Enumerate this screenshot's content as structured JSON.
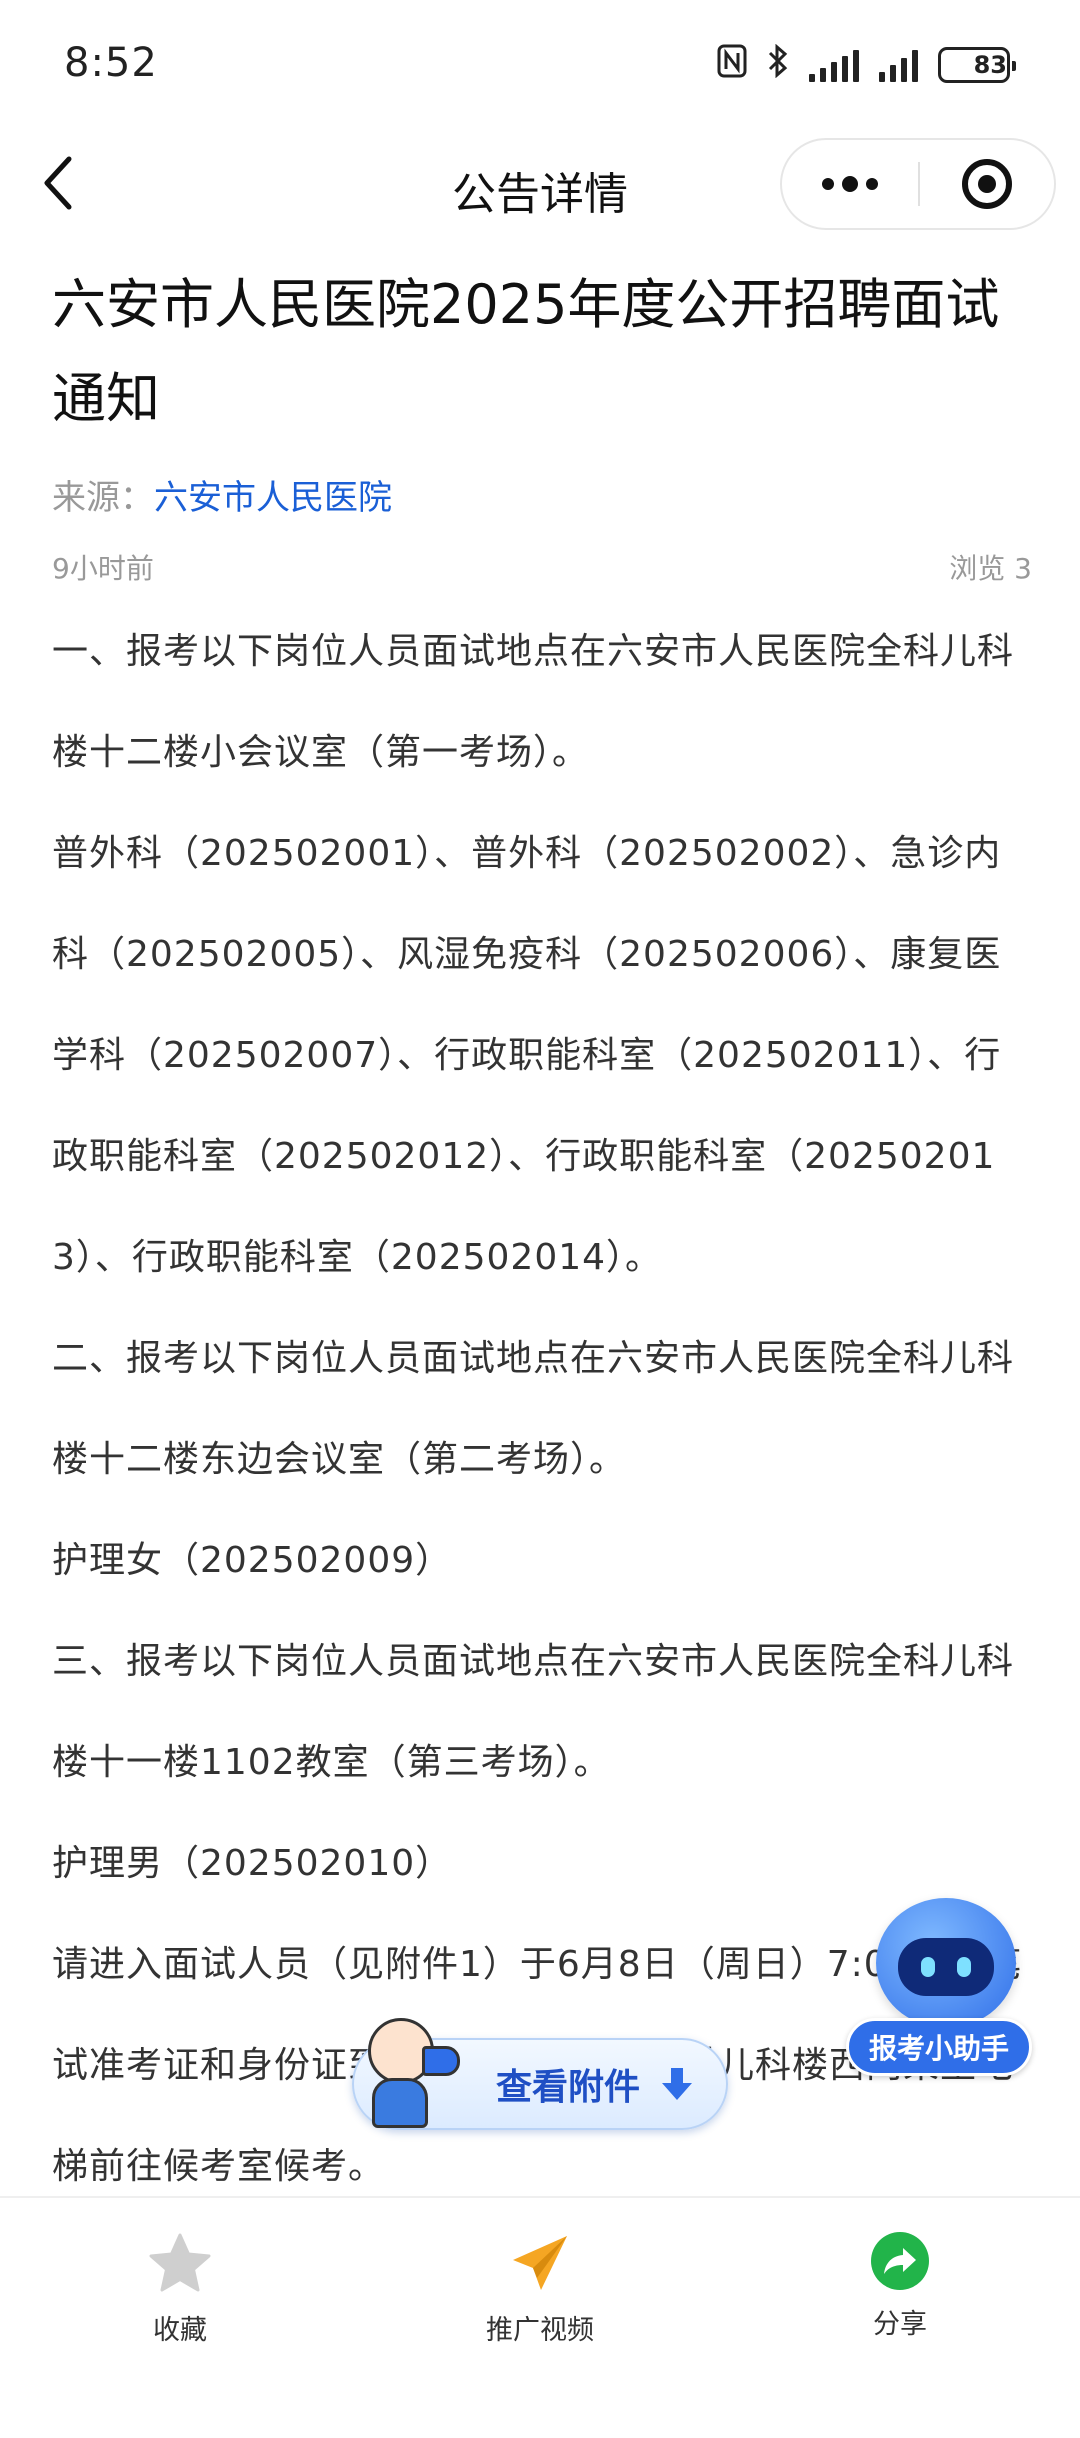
{
  "status": {
    "time": "8:52",
    "battery": "83",
    "battery_level": 0.83,
    "icons": [
      "nfc-icon",
      "bluetooth-icon",
      "signal-icon",
      "signal-icon",
      "battery-icon"
    ]
  },
  "nav": {
    "title": "公告详情",
    "back_icon": "back-arrow-icon",
    "more_icon": "more-dots-icon",
    "close_icon": "target-close-icon"
  },
  "article": {
    "title": "六安市人民医院2025年度公开招聘面试通知",
    "source_label": "来源：",
    "source_name": "六安市人民医院",
    "time_ago": "9小时前",
    "views": "浏览 3",
    "paragraphs": [
      "一、报考以下岗位人员面试地点在六安市人民医院全科儿科楼十二楼小会议室（第一考场）。",
      "普外科（202502001）、普外科（202502002）、急诊内科（202502005）、风湿免疫科（202502006）、康复医学科（202502007）、行政职能科室（202502011）、行政职能科室（202502012）、行政职能科室（202502013）、行政职能科室（202502014）。",
      "二、报考以下岗位人员面试地点在六安市人民医院全科儿科楼十二楼东边会议室（第二考场）。",
      "护理女（202502009）",
      "三、报考以下岗位人员面试地点在六安市人民医院全科儿科楼十一楼1102教室（第三考场）。",
      "护理男（202502010）",
      "请进入面试人员（见附件1）于6月8日（周日）7:00前凭笔试准考证和身份证到六安市人民医院全科儿科楼西门乘坐电梯前往候考室候考。"
    ]
  },
  "floating": {
    "assistant_label": "报考小助手",
    "attachment_label": "查看附件"
  },
  "bottom_bar": {
    "collect": "收藏",
    "video": "推广视频",
    "share": "分享"
  },
  "colors": {
    "link": "#1a5fd6",
    "assistant": "#2f6ee8",
    "share": "#22b44a",
    "video": "#f5a623",
    "star": "#cfcfcf"
  }
}
